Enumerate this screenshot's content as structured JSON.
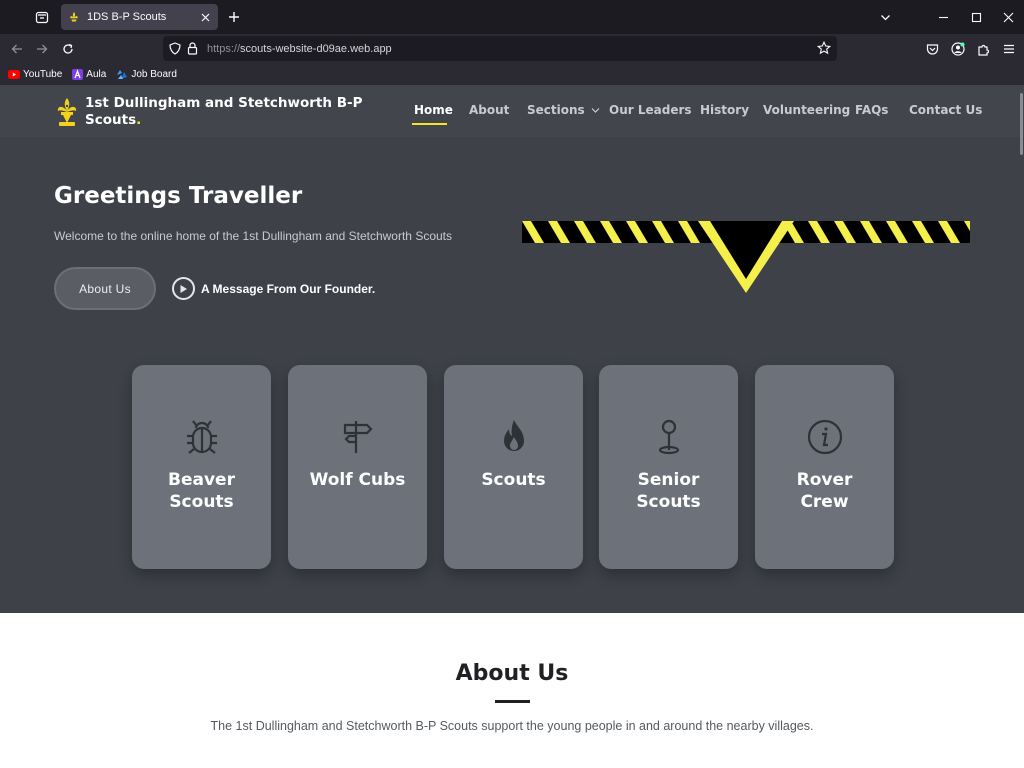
{
  "browser": {
    "tab": {
      "title": "1DS B-P Scouts"
    },
    "url": {
      "protocol": "https://",
      "host": "scouts-website-d09ae.web.app"
    },
    "bookmarks": [
      {
        "label": "YouTube",
        "icon": "youtube-icon"
      },
      {
        "label": "Aula",
        "icon": "aula-icon"
      },
      {
        "label": "Job Board",
        "icon": "job-board-icon"
      }
    ]
  },
  "site": {
    "brand": {
      "line1": "1st Dullingham and Stetchworth B-P",
      "line2": "Scouts",
      "dot": "."
    },
    "nav": {
      "home": "Home",
      "about": "About",
      "sections": "Sections",
      "leaders": "Our Leaders",
      "history": "History",
      "volunteering": "Volunteering",
      "faqs": "FAQs",
      "contact": "Contact Us"
    },
    "colors": {
      "accent": "#f4e52b",
      "hero_bg": "#3e4148",
      "card_bg": "#6c717a"
    }
  },
  "hero": {
    "title": "Greetings Traveller",
    "subtitle": "Welcome to the online home of the 1st Dullingham and Stetchworth Scouts",
    "about_button": "About Us",
    "founder_link": "A Message From Our Founder."
  },
  "sections": [
    {
      "line1": "Beaver",
      "line2": "Scouts",
      "icon": "bug-icon"
    },
    {
      "line1": "Wolf Cubs",
      "line2": "",
      "icon": "signpost-icon"
    },
    {
      "line1": "Scouts",
      "line2": "",
      "icon": "flame-icon"
    },
    {
      "line1": "Senior",
      "line2": "Scouts",
      "icon": "map-pin-icon"
    },
    {
      "line1": "Rover",
      "line2": "Crew",
      "icon": "info-icon"
    }
  ],
  "about": {
    "title": "About Us",
    "text": "The 1st Dullingham and Stetchworth B-P Scouts support the young people in and around the nearby villages."
  }
}
